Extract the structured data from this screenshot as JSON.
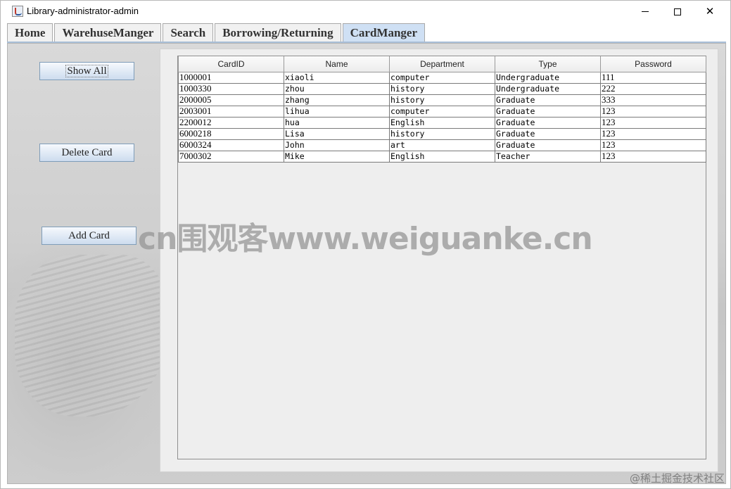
{
  "window": {
    "title": "Library-administrator-admin",
    "controls": {
      "minimize": "—",
      "maximize": "□",
      "close": "✕"
    }
  },
  "tabs": [
    {
      "label": "Home",
      "active": false
    },
    {
      "label": "WarehuseManger",
      "active": false
    },
    {
      "label": "Search",
      "active": false
    },
    {
      "label": "Borrowing/Returning",
      "active": false
    },
    {
      "label": "CardManger",
      "active": true
    }
  ],
  "sidebar": {
    "show_all": "Show All",
    "delete_card": "Delete Card",
    "add_card": "Add Card"
  },
  "table": {
    "columns": [
      "CardID",
      "Name",
      "Department",
      "Type",
      "Password"
    ],
    "rows": [
      [
        "1000001",
        "xiaoli",
        "computer",
        "Undergraduate",
        "111"
      ],
      [
        "1000330",
        "zhou",
        "history",
        "Undergraduate",
        "222"
      ],
      [
        "2000005",
        "zhang",
        "history",
        "Graduate",
        "333"
      ],
      [
        "2003001",
        "lihua",
        "computer",
        "Graduate",
        "123"
      ],
      [
        "2200012",
        "hua",
        "English",
        "Graduate",
        "123"
      ],
      [
        "6000218",
        "Lisa",
        "history",
        "Graduate",
        "123"
      ],
      [
        "6000324",
        "John",
        "art",
        "Graduate",
        "123"
      ],
      [
        "7000302",
        "Mike",
        "English",
        "Teacher",
        "123"
      ]
    ]
  },
  "overlays": {
    "watermark": "cn围观客www.weiguanke.cn",
    "corner": "@稀土掘金技术社区"
  },
  "colors": {
    "active_tab": "#cfe0f4",
    "button_border": "#7f9db9",
    "panel_bg": "#eeeeee"
  }
}
